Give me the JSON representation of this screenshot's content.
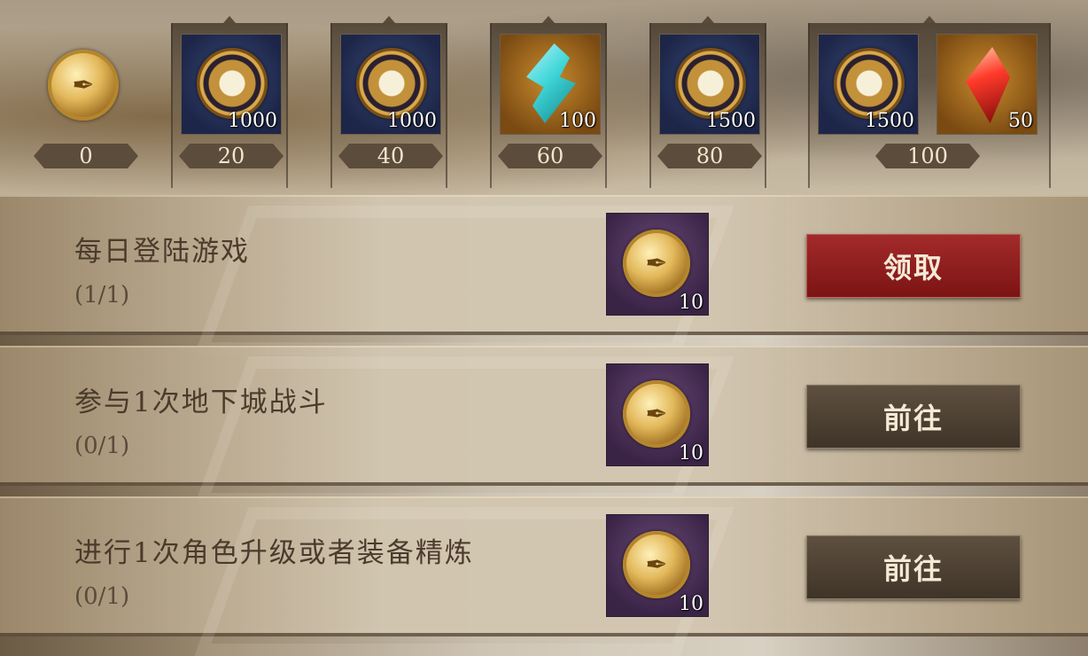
{
  "current_points": "0",
  "milestones": [
    {
      "threshold": "20",
      "rewards": [
        {
          "icon": "gold-medal-icon",
          "qty": "1000",
          "bg": "blue"
        }
      ]
    },
    {
      "threshold": "40",
      "rewards": [
        {
          "icon": "gold-medal-icon",
          "qty": "1000",
          "bg": "blue"
        }
      ]
    },
    {
      "threshold": "60",
      "rewards": [
        {
          "icon": "cyan-shard-icon",
          "qty": "100",
          "bg": "orange"
        }
      ]
    },
    {
      "threshold": "80",
      "rewards": [
        {
          "icon": "gold-medal-icon",
          "qty": "1500",
          "bg": "blue"
        }
      ]
    },
    {
      "threshold": "100",
      "rewards": [
        {
          "icon": "gold-medal-icon",
          "qty": "1500",
          "bg": "blue"
        },
        {
          "icon": "red-crystal-icon",
          "qty": "50",
          "bg": "orange"
        }
      ]
    }
  ],
  "tasks": [
    {
      "title": "每日登陆游戏",
      "progress": "(1/1)",
      "reward_qty": "10",
      "button": "领取",
      "button_style": "red"
    },
    {
      "title": "参与1次地下城战斗",
      "progress": "(0/1)",
      "reward_qty": "10",
      "button": "前往",
      "button_style": "dark"
    },
    {
      "title": "进行1次角色升级或者装备精炼",
      "progress": "(0/1)",
      "reward_qty": "10",
      "button": "前往",
      "button_style": "dark"
    }
  ],
  "colors": {
    "claim_button": "#8f1f1f",
    "go_button": "#4d4132",
    "reward_bg_purple": "#4a2e58"
  }
}
